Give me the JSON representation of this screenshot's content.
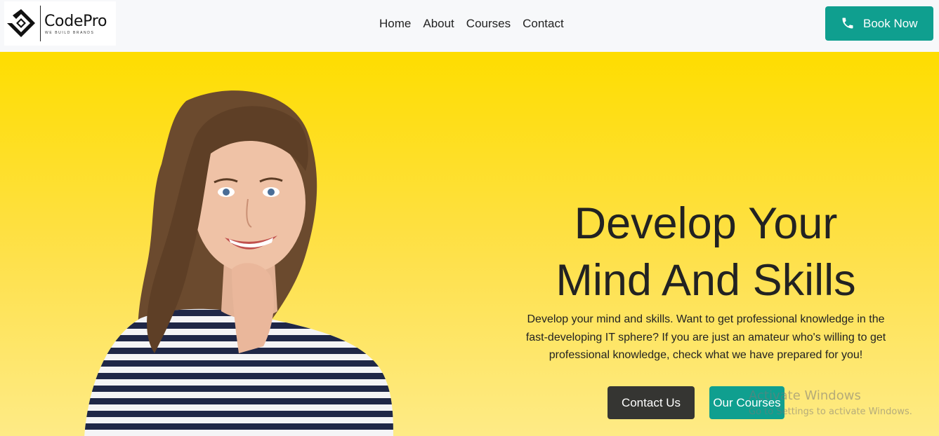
{
  "brand": {
    "name": "CodePro",
    "tagline": "WE BUILD BRANDS"
  },
  "nav": {
    "links": [
      "Home",
      "About",
      "Courses",
      "Contact"
    ]
  },
  "cta": {
    "book_label": "Book Now"
  },
  "hero": {
    "headline_line1": "Develop Your",
    "headline_line2": "Mind And Skills",
    "description": "Develop your mind and skills. Want to get professional knowledge in the fast-developing IT sphere? If you are just an amateur who's willing to get professional knowledge, check what we have prepared for you!",
    "contact_label": "Contact Us",
    "courses_label": "Our Courses"
  },
  "watermark": {
    "title": "Activate Windows",
    "subtitle": "Go to Settings to activate Windows."
  },
  "colors": {
    "accent": "#0f9f8f",
    "hero_yellow": "#fedd00",
    "dark_button": "#353532"
  }
}
